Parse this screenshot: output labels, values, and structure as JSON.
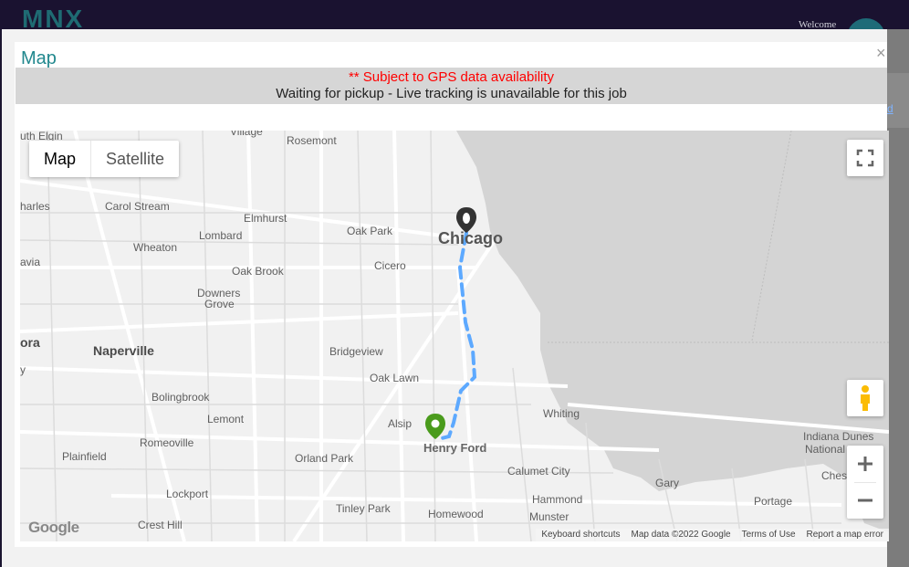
{
  "background": {
    "logo_text": "MNX",
    "welcome_text": "Welcome",
    "right_link_text": "d"
  },
  "modal": {
    "title": "Map",
    "close_label": "×",
    "notice_warning": "** Subject to GPS data availability",
    "notice_status": "Waiting for pickup - Live tracking is unavailable for this job"
  },
  "map": {
    "type_buttons": {
      "map": "Map",
      "satellite": "Satellite"
    },
    "cities": {
      "elgin": "uth Elgin",
      "village": "Village",
      "rosemont": "Rosemont",
      "charles": "harles",
      "carol_stream": "Carol Stream",
      "elmhurst": "Elmhurst",
      "oak_park": "Oak Park",
      "chicago": "Chicago",
      "wheaton": "Wheaton",
      "lombard": "Lombard",
      "avia": "avia",
      "cicero": "Cicero",
      "oak_brook": "Oak Brook",
      "downers": "Downers",
      "grove": "Grove",
      "aurora": "ora",
      "naperville": "Naperville",
      "bridgeview": "Bridgeview",
      "y": "y",
      "oak_lawn": "Oak Lawn",
      "bolingbrook": "Bolingbrook",
      "lemont": "Lemont",
      "alsip": "Alsip",
      "henry_ford": "Henry Ford",
      "whiting": "Whiting",
      "romeoville": "Romeoville",
      "plainfield": "Plainfield",
      "orland_park": "Orland Park",
      "calumet_city": "Calumet City",
      "gary": "Gary",
      "hammond": "Hammond",
      "lockport": "Lockport",
      "tinley_park": "Tinley Park",
      "homewood": "Homewood",
      "munster": "Munster",
      "portage": "Portage",
      "crest_hill": "Crest Hill",
      "indiana_dunes": "Indiana Dunes",
      "national": "National",
      "chest": "Chest"
    },
    "google_logo": "Google",
    "footer": {
      "shortcuts": "Keyboard shortcuts",
      "map_data": "Map data ©2022 Google",
      "terms": "Terms of Use",
      "report": "Report a map error"
    },
    "colors": {
      "route": "#5da9ff",
      "origin_marker": "#4a9b1c",
      "destination_marker": "#333333",
      "lake": "#d4d4d4",
      "land": "#f1f1f1"
    },
    "icons": {
      "fullscreen": "fullscreen-icon",
      "pegman": "pegman-icon",
      "zoom_in": "plus-icon",
      "zoom_out": "minus-icon"
    }
  }
}
